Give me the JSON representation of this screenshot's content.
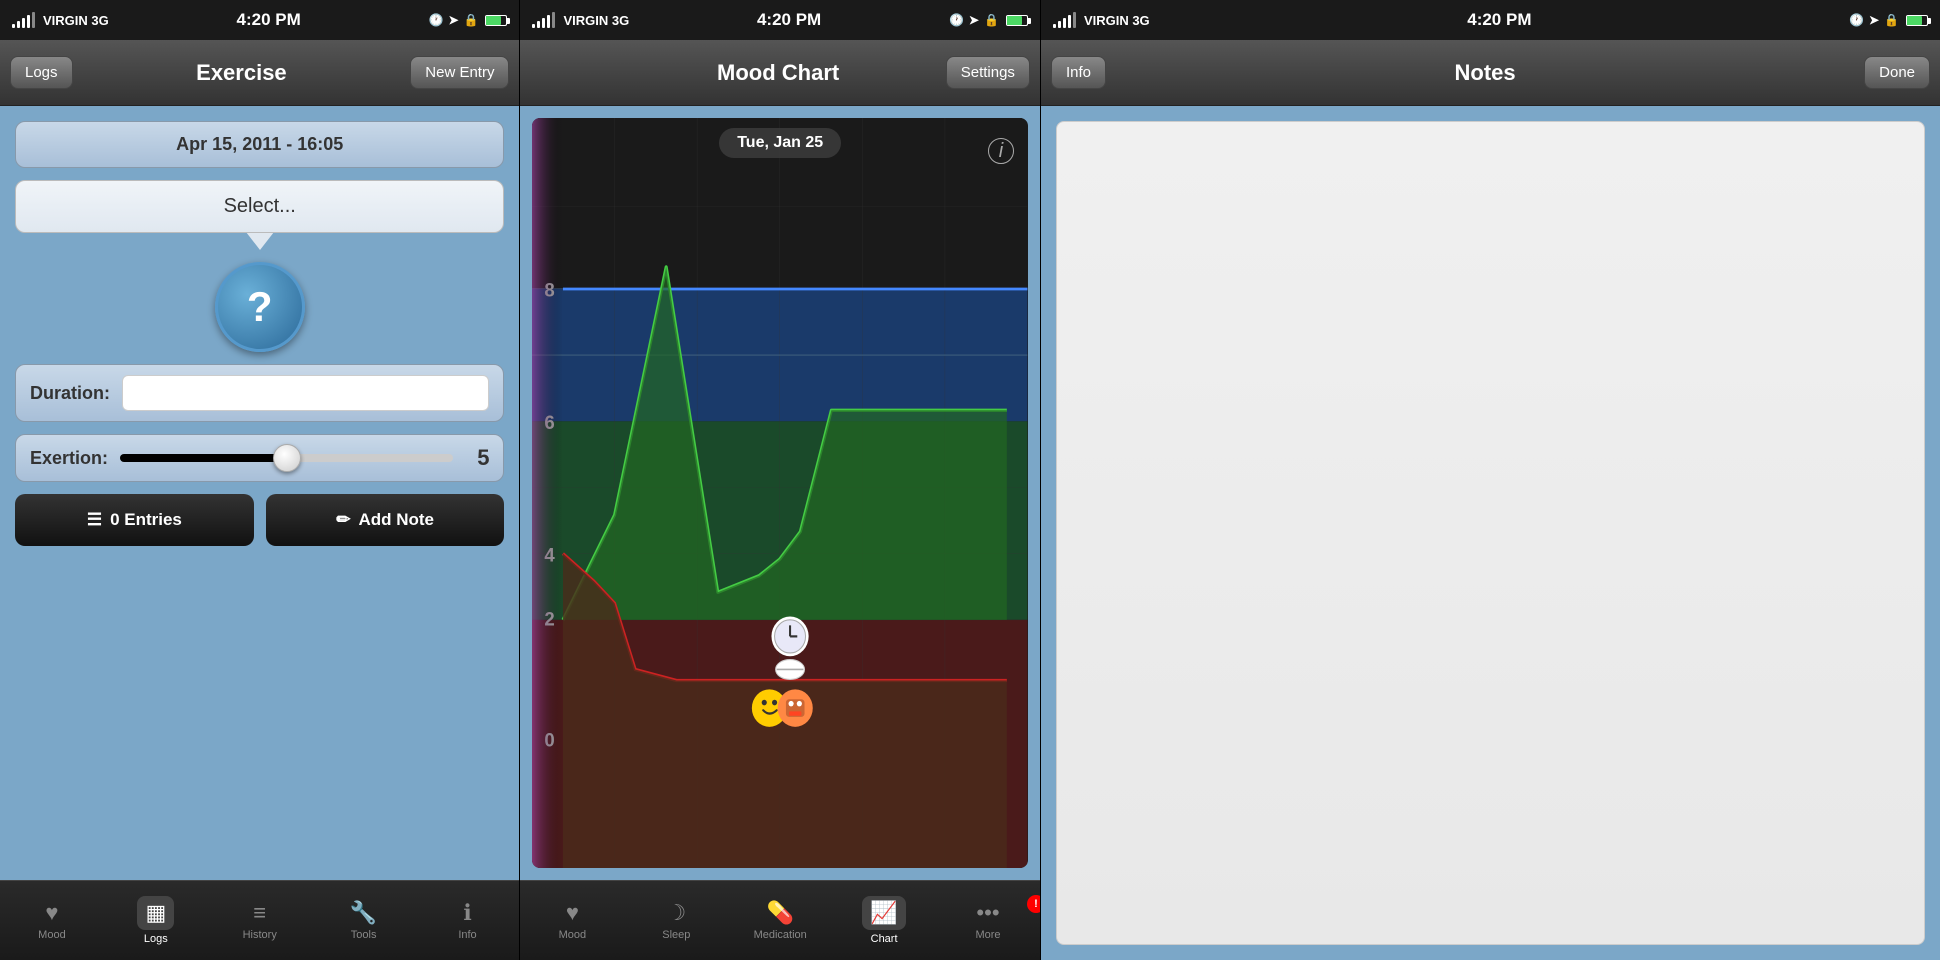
{
  "panel1": {
    "status": {
      "carrier": "VIRGIN 3G",
      "time": "4:20 PM"
    },
    "nav": {
      "left_btn": "Logs",
      "title": "Exercise",
      "right_btn": "New Entry"
    },
    "date_label": "Apr 15, 2011 - 16:05",
    "select_placeholder": "Select...",
    "duration_label": "Duration:",
    "exertion_label": "Exertion:",
    "exertion_value": "5",
    "btn_entries": "0 Entries",
    "btn_add_note": "Add Note",
    "tabs": [
      {
        "id": "mood",
        "label": "Mood",
        "icon": "♥",
        "active": false
      },
      {
        "id": "logs",
        "label": "Logs",
        "icon": "▦",
        "active": true
      },
      {
        "id": "history",
        "label": "History",
        "icon": "≡",
        "active": false
      },
      {
        "id": "tools",
        "label": "Tools",
        "icon": "🔧",
        "active": false
      },
      {
        "id": "info",
        "label": "Info",
        "icon": "ℹ",
        "active": false
      }
    ]
  },
  "panel2": {
    "status": {
      "carrier": "VIRGIN 3G",
      "time": "4:20 PM"
    },
    "nav": {
      "title": "Mood Chart",
      "right_btn": "Settings"
    },
    "chart_date": "Tue, Jan 25",
    "tabs": [
      {
        "id": "mood",
        "label": "Mood",
        "icon": "♥",
        "active": false
      },
      {
        "id": "sleep",
        "label": "Sleep",
        "icon": "☽",
        "active": false
      },
      {
        "id": "medication",
        "label": "Medication",
        "icon": "💊",
        "active": false
      },
      {
        "id": "chart",
        "label": "Chart",
        "icon": "📈",
        "active": true
      },
      {
        "id": "more",
        "label": "More",
        "icon": "•••",
        "active": false,
        "badge": "!"
      }
    ]
  },
  "panel3": {
    "status": {
      "carrier": "VIRGIN 3G",
      "time": "4:20 PM"
    },
    "nav": {
      "left_btn": "Info",
      "title": "Notes",
      "right_btn": "Done"
    },
    "notes_placeholder": ""
  }
}
